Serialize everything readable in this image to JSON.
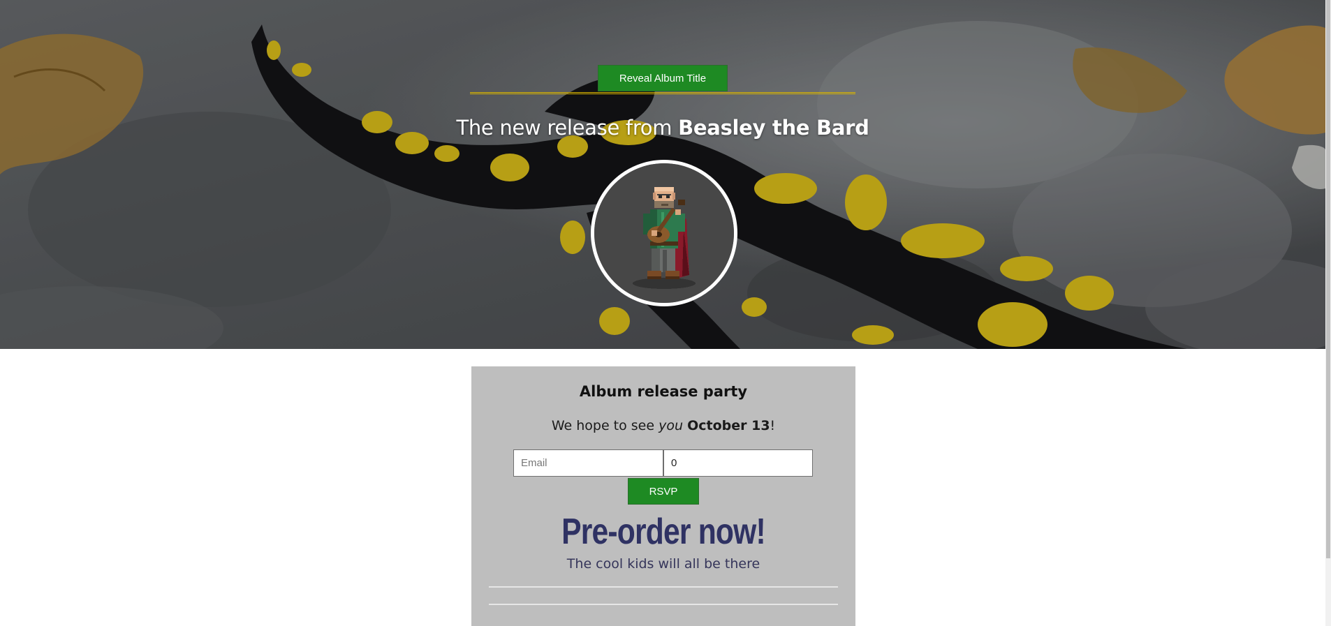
{
  "hero": {
    "reveal_button_label": "Reveal Album Title",
    "headline_prefix": "The new release from ",
    "artist_name": "Beasley the Bard"
  },
  "party": {
    "title": "Album release party",
    "invite_prefix": "We hope to see ",
    "invite_emphasis": "you",
    "invite_date": "October 13",
    "invite_suffix": "!",
    "email_placeholder": "Email",
    "count_value": "0",
    "rsvp_label": "RSVP"
  },
  "preorder": {
    "heading": "Pre-order now!",
    "subtext": "The cool kids will all be there"
  },
  "colors": {
    "button_green": "#1e8a23",
    "gold_rule": "#d8b400",
    "card_bg": "#bebebe",
    "preorder_navy": "#2f3263"
  }
}
